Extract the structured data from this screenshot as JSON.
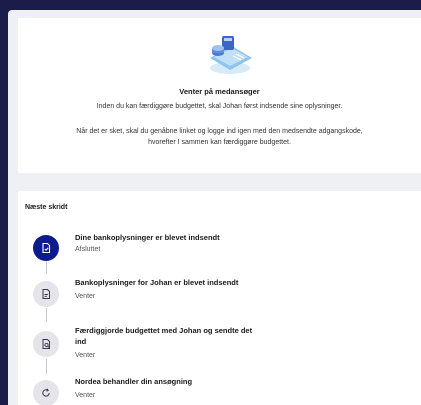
{
  "status": {
    "title": "Venter på medansøger",
    "line1": "Inden du kan færdiggøre budgettet, skal Johan først indsende sine oplysninger.",
    "line2": "Når det er sket, skal du genåbne linket og logge ind igen med den medsendte adgangskode,",
    "line3": "hvorefter I sammen kan færdiggøre budgettet."
  },
  "steps": {
    "heading": "Næste skridt",
    "items": [
      {
        "title": "Dine bankoplysninger er blevet indsendt",
        "status": "Afsluttet",
        "icon": "document-check-icon",
        "completed": true
      },
      {
        "title": "Bankoplysninger for Johan er blevet indsendt",
        "status": "Venter",
        "icon": "document-icon",
        "completed": false
      },
      {
        "title_line1": "Færdiggjorde budgettet med Johan og sendte det",
        "title_line2": "ind",
        "status": "Venter",
        "icon": "document-search-icon",
        "completed": false
      },
      {
        "title": "Nordea behandler din ansøgning",
        "status": "Venter",
        "icon": "circular-arrow-icon",
        "completed": false
      }
    ]
  },
  "colors": {
    "accent": "#0c1b8e",
    "background": "#1b1c4a",
    "panel": "#eff0f4"
  }
}
